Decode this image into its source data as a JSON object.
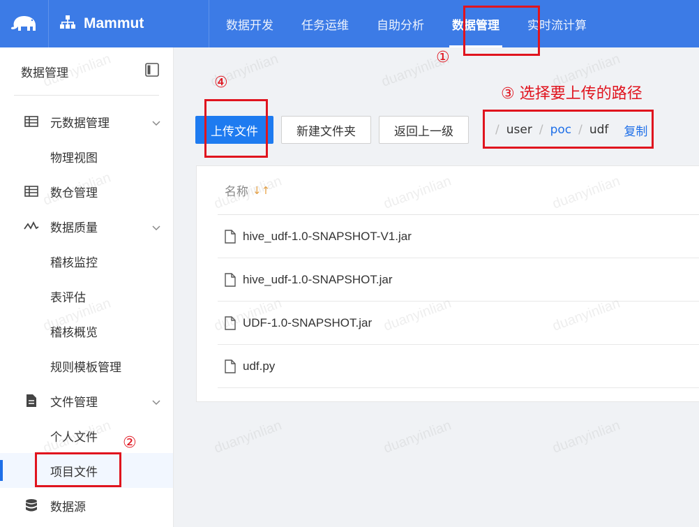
{
  "app": {
    "brand": "Mammut"
  },
  "nav": {
    "tabs": [
      {
        "label": "数据开发"
      },
      {
        "label": "任务运维"
      },
      {
        "label": "自助分析"
      },
      {
        "label": "数据管理",
        "active": true
      },
      {
        "label": "实时流计算"
      }
    ]
  },
  "sidebar": {
    "title": "数据管理",
    "items": [
      {
        "label": "元数据管理",
        "icon": "table-icon",
        "expandable": true
      },
      {
        "label": "物理视图",
        "sub": true
      },
      {
        "label": "数仓管理",
        "icon": "table-icon"
      },
      {
        "label": "数据质量",
        "icon": "pulse-icon",
        "expandable": true
      },
      {
        "label": "稽核监控",
        "sub": true
      },
      {
        "label": "表评估",
        "sub": true
      },
      {
        "label": "稽核概览",
        "sub": true
      },
      {
        "label": "规则模板管理",
        "sub": true
      },
      {
        "label": "文件管理",
        "icon": "file-icon",
        "expandable": true
      },
      {
        "label": "个人文件",
        "sub": true
      },
      {
        "label": "项目文件",
        "sub": true,
        "selected": true
      },
      {
        "label": "数据源",
        "icon": "database-icon"
      }
    ]
  },
  "toolbar": {
    "upload_label": "上传文件",
    "new_folder_label": "新建文件夹",
    "back_label": "返回上一级"
  },
  "breadcrumb": {
    "segments": [
      "user",
      "poc",
      "udf"
    ],
    "copy_label": "复制"
  },
  "file_table": {
    "name_header": "名称",
    "sort_glyph": "↓↑",
    "files": [
      "hive_udf-1.0-SNAPSHOT-V1.jar",
      "hive_udf-1.0-SNAPSHOT.jar",
      "UDF-1.0-SNAPSHOT.jar",
      "udf.py"
    ]
  },
  "annotations": {
    "step1": "①",
    "step2": "②",
    "step3": "③ 选择要上传的路径",
    "step4": "④"
  },
  "watermark": "duanyinlian",
  "colors": {
    "nav_bg": "#3c7be6",
    "primary": "#1e7bf0",
    "annotation": "#e0141e",
    "link": "#1e6fe8"
  }
}
